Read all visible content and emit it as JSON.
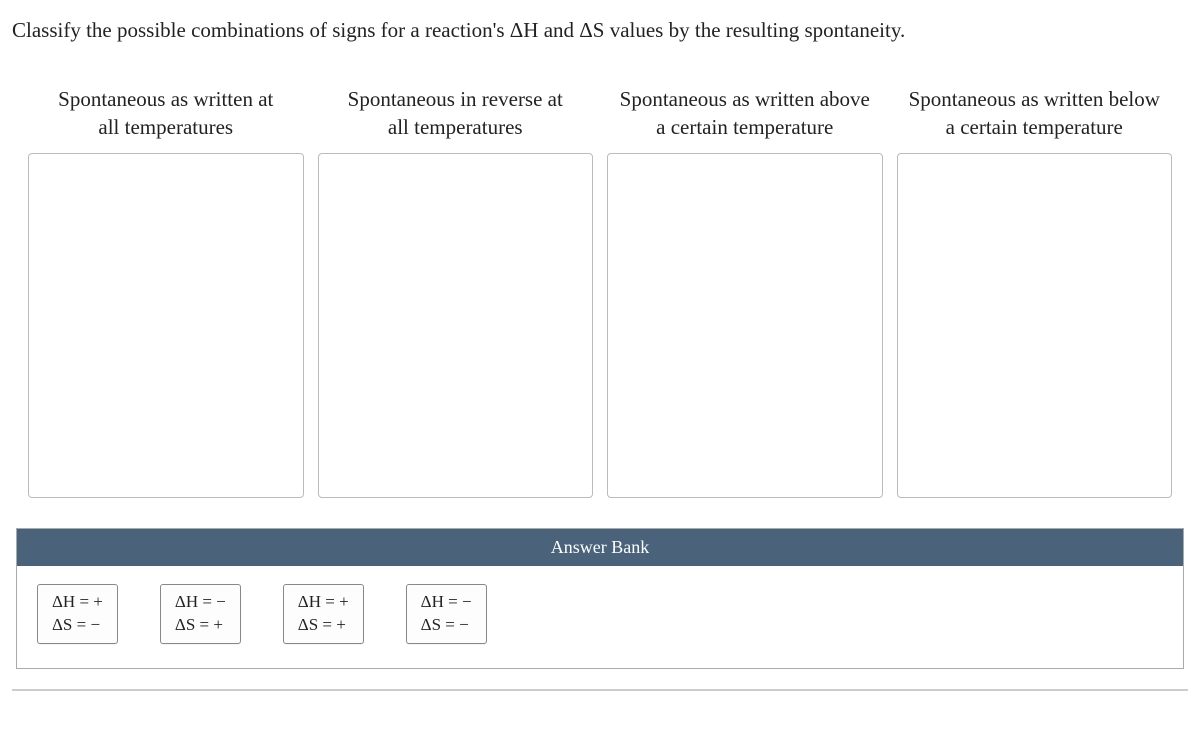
{
  "question": "Classify the possible combinations of signs for a reaction's ΔH and ΔS values by the resulting spontaneity.",
  "categories": [
    {
      "line1": "Spontaneous as written at",
      "line2": "all temperatures"
    },
    {
      "line1": "Spontaneous in reverse at",
      "line2": "all temperatures"
    },
    {
      "line1": "Spontaneous as written above",
      "line2": "a certain temperature"
    },
    {
      "line1": "Spontaneous as written below",
      "line2": "a certain temperature"
    }
  ],
  "answerBank": {
    "title": "Answer Bank",
    "tiles": [
      {
        "dh": "ΔH = +",
        "ds": "ΔS = −"
      },
      {
        "dh": "ΔH = −",
        "ds": "ΔS = +"
      },
      {
        "dh": "ΔH = +",
        "ds": "ΔS = +"
      },
      {
        "dh": "ΔH = −",
        "ds": "ΔS = −"
      }
    ]
  }
}
